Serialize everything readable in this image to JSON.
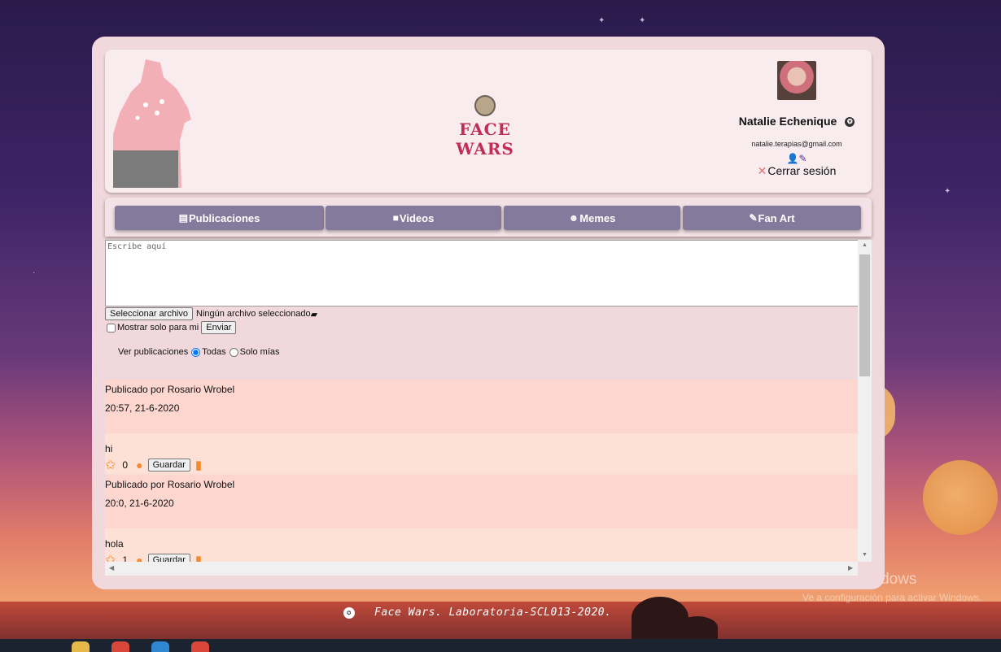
{
  "header": {
    "logo_text": "FACE WARS",
    "user_name": "Natalie Echenique",
    "email": "natalie.terapias@gmail.com",
    "logout_label": "Cerrar sesión"
  },
  "nav": {
    "tabs": [
      {
        "label": "Publicaciones"
      },
      {
        "label": "Videos"
      },
      {
        "label": "Memes"
      },
      {
        "label": "Fan Art"
      }
    ]
  },
  "composer": {
    "placeholder": "Escribe aquí",
    "file_button": "Seleccionar archivo",
    "file_status": "Ningún archivo seleccionado",
    "private_label": "Mostrar solo para mi",
    "send_button": "Enviar"
  },
  "filter": {
    "label": "Ver publicaciones",
    "option_all": "Todas",
    "option_mine": "Solo mías",
    "selected": "Todas"
  },
  "posts": [
    {
      "author": "Publicado por Rosario Wrobel",
      "date": "20:57, 21-6-2020",
      "text": "hi",
      "likes": "0",
      "save_label": "Guardar"
    },
    {
      "author": "Publicado por Rosario Wrobel",
      "date": "20:0, 21-6-2020",
      "text": "hola",
      "likes": "1",
      "save_label": "Guardar"
    }
  ],
  "footer": {
    "text": "Face Wars. Laboratoria-SCL013-2020."
  },
  "watermark": {
    "title": "Activar Windows",
    "subtitle": "Ve a configuración para activar Windows."
  },
  "colors": {
    "tab_bg": "#847a9c",
    "accent_orange": "#f08a2a",
    "logo_red": "#c02d55"
  }
}
